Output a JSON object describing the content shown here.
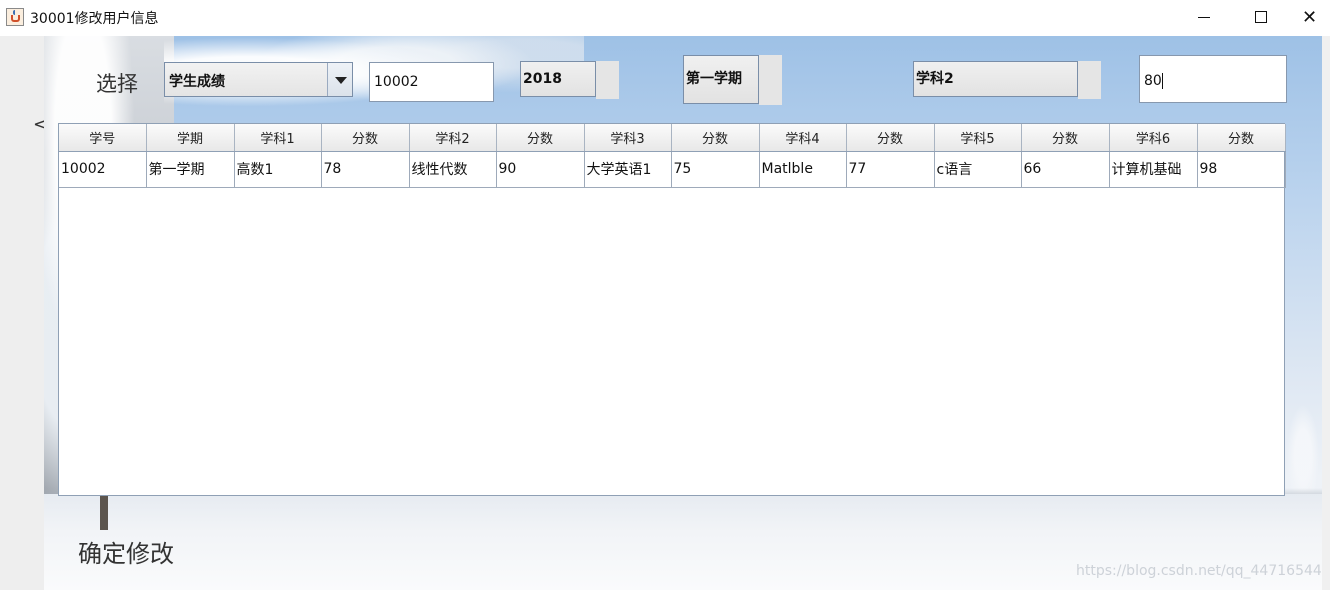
{
  "window": {
    "title": "30001修改用户信息",
    "close_glyph": "✕"
  },
  "toolbar": {
    "left_glyph": "<",
    "select_label": "选择",
    "category_select": {
      "selected": "学生成绩"
    },
    "student_id_value": "10002",
    "year_button": "2018",
    "term_button": "第一学期",
    "subject_button": "学科2",
    "score_value": "80"
  },
  "table": {
    "headers": [
      "学号",
      "学期",
      "学科1",
      "分数",
      "学科2",
      "分数",
      "学科3",
      "分数",
      "学科4",
      "分数",
      "学科5",
      "分数",
      "学科6",
      "分数"
    ],
    "rows": [
      [
        "10002",
        "第一学期",
        "高数1",
        "78",
        "线性代数",
        "90",
        "大学英语1",
        "75",
        "Matlble",
        "77",
        "c语言",
        "66",
        "计算机基础",
        "98"
      ]
    ]
  },
  "confirm_label": "确定修改",
  "watermark": "https://blog.csdn.net/qq_44716544"
}
